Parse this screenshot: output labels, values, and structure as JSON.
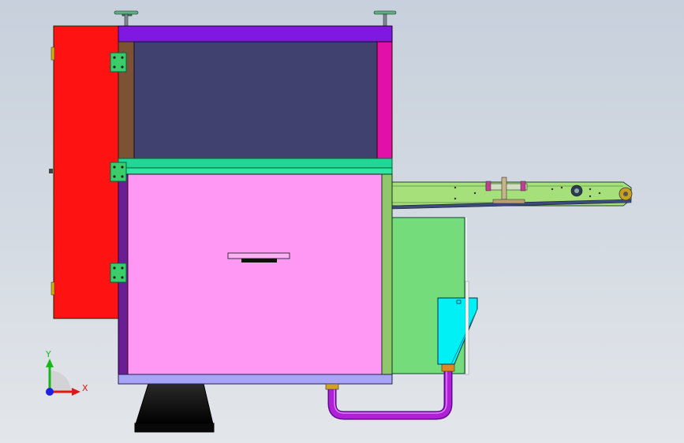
{
  "viewport": {
    "axis_x_label": "X",
    "axis_y_label": "Y"
  },
  "colors": {
    "background_top": "#c7d0dc",
    "door_panel": "#ff1212",
    "top_frame": "#7f18e0",
    "upper_chamber": "#41416f",
    "side_post_left": "#7d5234",
    "side_post_right": "#e010a8",
    "middle_rail": "#22d696",
    "lower_cabinet": "#ff98f4",
    "lower_left_strip": "#6a1e96",
    "lower_right_strip": "#8ec86a",
    "bottom_rail": "#a8a4f8",
    "conveyor": "#a6e07a",
    "side_box": "#74dc7a",
    "hopper": "#00f0f6",
    "pipe": "#b020d8",
    "stand": "#0c0c0c",
    "hinge": "#3acd6a",
    "axis_x": "#e01818",
    "axis_y": "#18b818",
    "axis_z": "#2020e0"
  }
}
